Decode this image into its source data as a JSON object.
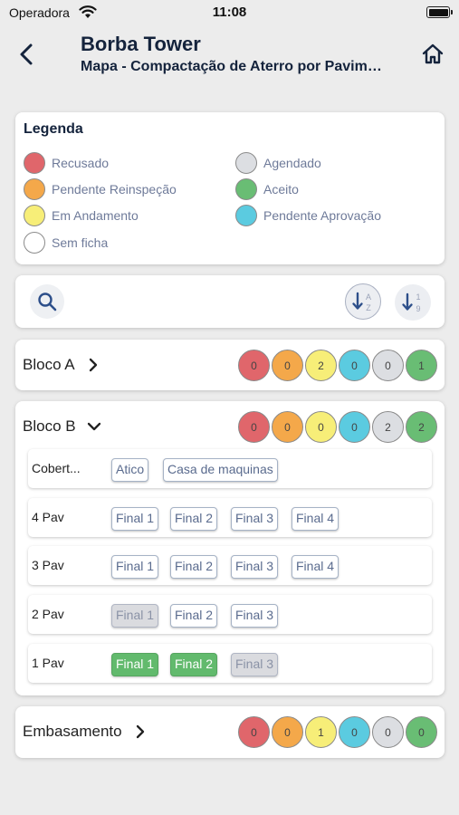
{
  "status_bar": {
    "carrier": "Operadora",
    "time": "11:08"
  },
  "header": {
    "title": "Borba Tower",
    "subtitle": "Mapa - Compactação de Aterro por Pavimento"
  },
  "legend": {
    "title": "Legenda",
    "items": [
      {
        "label": "Recusado",
        "color": "#e0666b"
      },
      {
        "label": "Agendado",
        "color": "#dcdee2"
      },
      {
        "label": "Pendente Reinspeção",
        "color": "#f4a84a"
      },
      {
        "label": "Aceito",
        "color": "#69bd74"
      },
      {
        "label": "Em Andamento",
        "color": "#f7ee78"
      },
      {
        "label": "Pendente Aprovação",
        "color": "#5bcbe0"
      },
      {
        "label": "Sem ficha",
        "color": "#ffffff"
      }
    ]
  },
  "search": {
    "icon": "search-icon",
    "sort_az": "sort-alpha-icon",
    "sort_19": "sort-numeric-icon"
  },
  "count_colors": [
    "#e0666b",
    "#f4a84a",
    "#f7ee78",
    "#5bcbe0",
    "#dcdee2",
    "#69bd74"
  ],
  "groups": {
    "bloco_a": {
      "name": "Bloco A",
      "expanded": false,
      "counts": [
        "0",
        "0",
        "2",
        "0",
        "0",
        "1"
      ]
    },
    "bloco_b": {
      "name": "Bloco B",
      "expanded": true,
      "counts": [
        "0",
        "0",
        "0",
        "0",
        "2",
        "2"
      ],
      "floors": [
        {
          "name": "Cobert...",
          "units": [
            {
              "label": "Atico",
              "state": "sem-ficha"
            },
            {
              "label": "Casa de maquinas",
              "state": "sem-ficha"
            }
          ]
        },
        {
          "name": "4 Pav",
          "units": [
            {
              "label": "Final 1",
              "state": "sem-ficha"
            },
            {
              "label": "Final 2",
              "state": "sem-ficha"
            },
            {
              "label": "Final 3",
              "state": "sem-ficha"
            },
            {
              "label": "Final 4",
              "state": "sem-ficha"
            }
          ]
        },
        {
          "name": "3 Pav",
          "units": [
            {
              "label": "Final 1",
              "state": "sem-ficha"
            },
            {
              "label": "Final 2",
              "state": "sem-ficha"
            },
            {
              "label": "Final 3",
              "state": "sem-ficha"
            },
            {
              "label": "Final 4",
              "state": "sem-ficha"
            }
          ]
        },
        {
          "name": "2 Pav",
          "units": [
            {
              "label": "Final 1",
              "state": "agendado"
            },
            {
              "label": "Final 2",
              "state": "sem-ficha"
            },
            {
              "label": "Final 3",
              "state": "sem-ficha"
            }
          ]
        },
        {
          "name": "1 Pav",
          "units": [
            {
              "label": "Final 1",
              "state": "aceito"
            },
            {
              "label": "Final 2",
              "state": "aceito"
            },
            {
              "label": "Final 3",
              "state": "agendado"
            }
          ]
        }
      ]
    },
    "embasamento": {
      "name": "Embasamento",
      "expanded": false,
      "counts": [
        "0",
        "0",
        "1",
        "0",
        "0",
        "0"
      ]
    }
  }
}
